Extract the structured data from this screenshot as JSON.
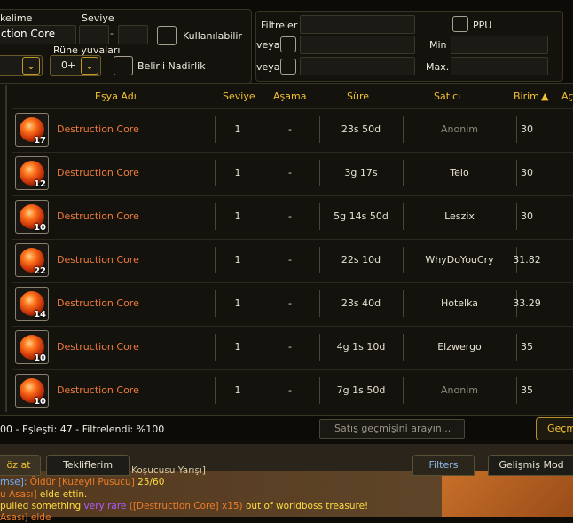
{
  "filters": {
    "word_label": "kelime",
    "name_value": "ction Core",
    "level_label": "Seviye",
    "level_min": "",
    "level_max": "",
    "level_dash": "-",
    "usable_label": "Kullanılabilir",
    "rune_slots_label": "Rüne yuvaları",
    "rune_value": "0+",
    "rarity_label": "Belirli Nadirlik"
  },
  "filter_panel": {
    "title": "Filtreler",
    "or_label_1": "veya",
    "or_label_2": "veya",
    "ppu_label": "PPU",
    "min_label": "Min",
    "max_label": "Max."
  },
  "table": {
    "headers": {
      "item_name": "Eşya Adı",
      "level": "Seviye",
      "stage": "Aşama",
      "duration": "Süre",
      "seller": "Satıcı",
      "unit": "Birim",
      "sort_arrow": "▲",
      "extra": "Aç"
    },
    "rows": [
      {
        "qty": "17",
        "name": "Destruction Core",
        "level": "1",
        "stage": "-",
        "duration": "23s 50d",
        "seller": "Anonim",
        "unit": "30"
      },
      {
        "qty": "12",
        "name": "Destruction Core",
        "level": "1",
        "stage": "-",
        "duration": "3g 17s",
        "seller": "Telo",
        "unit": "30"
      },
      {
        "qty": "10",
        "name": "Destruction Core",
        "level": "1",
        "stage": "-",
        "duration": "5g 14s 50d",
        "seller": "Leszix",
        "unit": "30"
      },
      {
        "qty": "22",
        "name": "Destruction Core",
        "level": "1",
        "stage": "-",
        "duration": "22s 10d",
        "seller": "WhyDoYouCry",
        "unit": "31.82"
      },
      {
        "qty": "14",
        "name": "Destruction Core",
        "level": "1",
        "stage": "-",
        "duration": "23s 40d",
        "seller": "Hotelka",
        "unit": "33.29"
      },
      {
        "qty": "10",
        "name": "Destruction Core",
        "level": "1",
        "stage": "-",
        "duration": "4g 1s 10d",
        "seller": "Elzwergo",
        "unit": "35"
      },
      {
        "qty": "10",
        "name": "Destruction Core",
        "level": "1",
        "stage": "-",
        "duration": "7g 1s 50d",
        "seller": "Anonim",
        "unit": "35"
      }
    ]
  },
  "status": {
    "summary": "00 - Eşleşti: 47 - Filtrelendi: %100",
    "search_placeholder": "Satış geçmişini arayın...",
    "history_button": "Geçm"
  },
  "tabs": {
    "left_tab": "öz at",
    "offers_tab": "Tekliflerim",
    "filters_tab": "Filters",
    "advanced_tab": "Gelişmiş Mod"
  },
  "chat": {
    "line1_prefix": "rnse]: ",
    "line1_action": "Öldür",
    "line1_target": "[Kuzeyli Pusucu]",
    "line1_count": " 25/60",
    "line0_text": "Koşucusu Yarışı]",
    "line2_prefix": "u Asası]",
    "line2_text": " elde ettin.",
    "line3_text": " pulled something ",
    "line3_rare": "very rare",
    "line3_item": " ([Destruction Core] x15)",
    "line3_tail": " out of worldboss treasure!",
    "line4_text": "Asası] elde"
  },
  "colors": {
    "accent": "#f2c230",
    "item_name": "#ef7a3c",
    "anon": "#8c8878",
    "rare": "#b15cff",
    "chat_orange": "#f07c28"
  }
}
